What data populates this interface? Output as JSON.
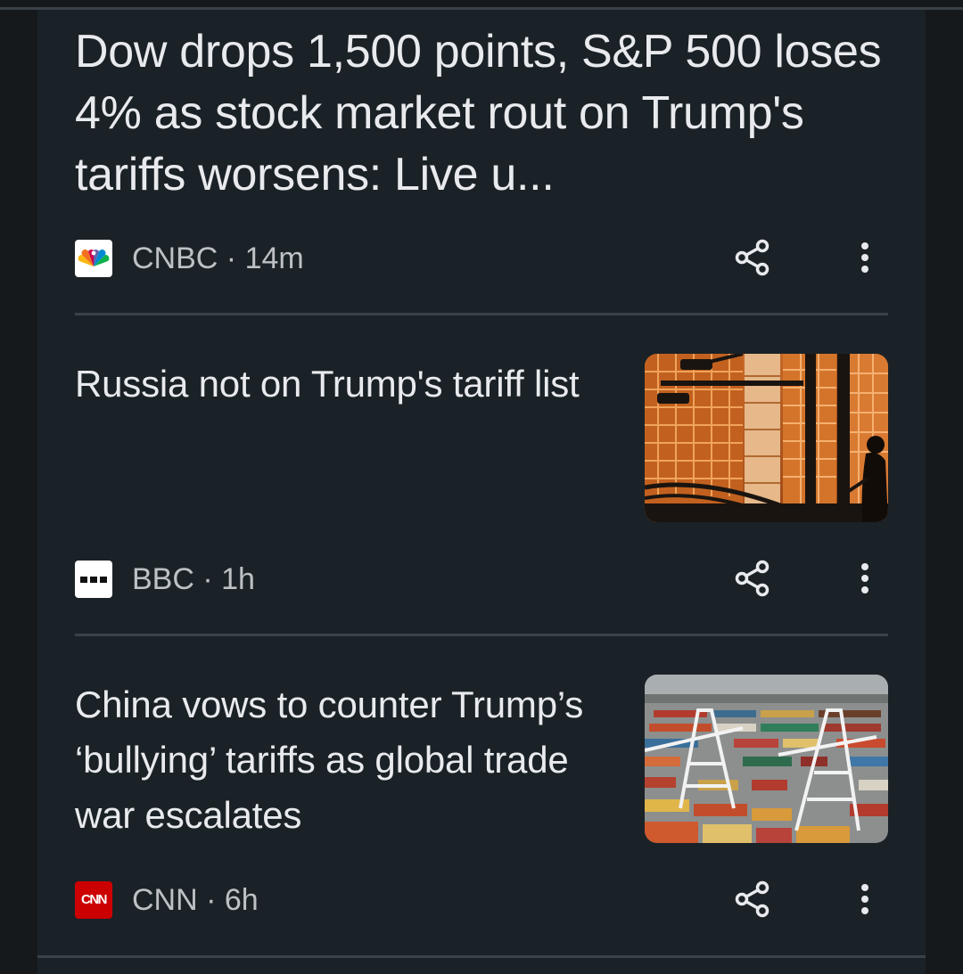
{
  "articles": [
    {
      "headline": "Dow drops 1,500 points, S&P 500 loses 4% as stock market rout on Trump's tariffs worsens: Live u...",
      "source": "CNBC",
      "age": "14m",
      "logo_icon": "nbc-peacock-icon",
      "has_image": false
    },
    {
      "headline": "Russia not on Trump's tariff list",
      "source": "BBC",
      "age": "1h",
      "logo_icon": "bbc-blocks-icon",
      "image_description_icon": "city-buildings-image",
      "has_image": true
    },
    {
      "headline": "China vows to counter Trump’s ‘bullying’ tariffs as global trade war escalates",
      "source": "CNN",
      "age": "6h",
      "logo_icon": "cnn-logo-icon",
      "logo_text": "CNN",
      "image_description_icon": "shipping-port-image",
      "has_image": true
    }
  ],
  "separator": " · ",
  "colors": {
    "background": "#15191c",
    "card": "#1b2227",
    "divider": "#3a4148",
    "headline_text": "#e8eaed",
    "meta_text": "#bdc1c6",
    "cnn_red": "#cc0000"
  }
}
